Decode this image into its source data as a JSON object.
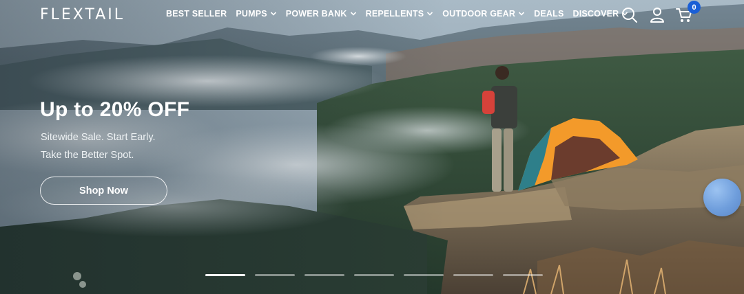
{
  "brand": {
    "logo_text": "FLEXTAIL"
  },
  "nav": {
    "items": [
      {
        "label": "BEST SELLER",
        "has_dropdown": false
      },
      {
        "label": "PUMPS",
        "has_dropdown": true
      },
      {
        "label": "POWER BANK",
        "has_dropdown": true
      },
      {
        "label": "REPELLENTS",
        "has_dropdown": true
      },
      {
        "label": "OUTDOOR GEAR",
        "has_dropdown": true
      },
      {
        "label": "DEALS",
        "has_dropdown": false
      },
      {
        "label": "DISCOVER",
        "has_dropdown": true
      }
    ]
  },
  "header_icons": {
    "search": "search-icon",
    "account": "user-icon",
    "cart": "cart-icon",
    "cart_count": "0"
  },
  "hero": {
    "headline": "Up to 20% OFF",
    "subline_1": "Sitewide Sale. Start Early.",
    "subline_2": "Take the Better Spot.",
    "cta_label": "Shop Now",
    "slides_total": 7,
    "active_slide": 1
  },
  "colors": {
    "badge": "#1a5fd6",
    "tent_orange": "#f39a2a",
    "tent_teal": "#2e7f8a",
    "text": "#ffffff"
  }
}
